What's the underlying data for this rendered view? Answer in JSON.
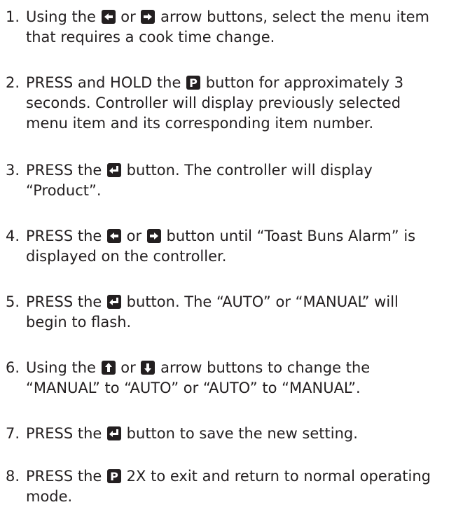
{
  "steps": [
    {
      "number": "1.",
      "lines": [
        [
          "Using the ",
          {
            "icon": "left-arrow-icon"
          },
          " or ",
          {
            "icon": "right-arrow-icon"
          },
          " arrow buttons, select the menu item"
        ],
        [
          "that requires a cook time change."
        ]
      ]
    },
    {
      "number": "2.",
      "lines": [
        [
          "PRESS and HOLD the ",
          {
            "icon": "p-button-icon"
          },
          " button for approximately 3"
        ],
        [
          "seconds. Controller will display previously selected"
        ],
        [
          "menu item and its corresponding item number."
        ]
      ]
    },
    {
      "number": "3.",
      "lines": [
        [
          "PRESS the ",
          {
            "icon": "enter-icon"
          },
          " button. The controller will display"
        ],
        [
          "“Product”."
        ]
      ]
    },
    {
      "number": "4.",
      "lines": [
        [
          "PRESS the ",
          {
            "icon": "left-arrow-icon"
          },
          " or ",
          {
            "icon": "right-arrow-icon"
          },
          " button until “Toast Buns Alarm” is"
        ],
        [
          "displayed on the controller."
        ]
      ]
    },
    {
      "number": "5.",
      "lines": [
        [
          "PRESS the ",
          {
            "icon": "enter-icon"
          },
          " button. The “AUTO” or “MANUAL” will"
        ],
        [
          "begin to flash."
        ]
      ]
    },
    {
      "number": "6.",
      "lines": [
        [
          "Using the ",
          {
            "icon": "up-arrow-icon"
          },
          " or ",
          {
            "icon": "down-arrow-icon"
          },
          " arrow buttons to change the"
        ],
        [
          "“MANUAL” to “AUTO” or “AUTO” to “MANUAL”."
        ]
      ]
    },
    {
      "number": "7.",
      "lines": [
        [
          "PRESS the ",
          {
            "icon": "enter-icon"
          },
          " button to save the new setting."
        ]
      ]
    },
    {
      "number": "8.",
      "lines": [
        [
          "PRESS the ",
          {
            "icon": "p-button-icon"
          },
          " 2X to exit and return to normal operating"
        ],
        [
          "mode."
        ]
      ]
    }
  ]
}
